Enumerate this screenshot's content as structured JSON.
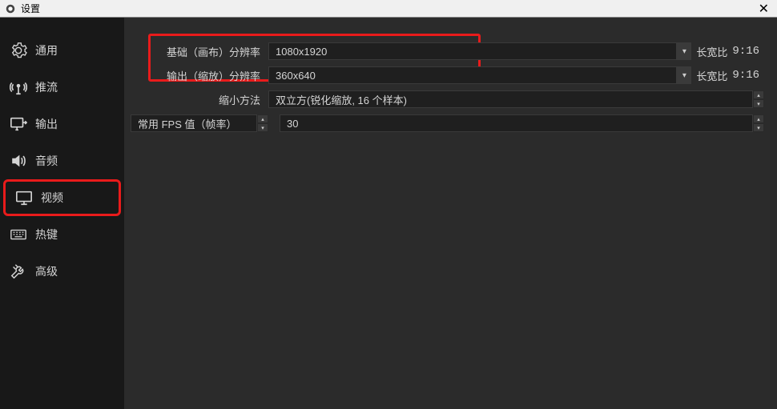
{
  "window": {
    "title": "设置",
    "close": "✕"
  },
  "sidebar": {
    "items": [
      {
        "label": "通用"
      },
      {
        "label": "推流"
      },
      {
        "label": "输出"
      },
      {
        "label": "音频"
      },
      {
        "label": "视频"
      },
      {
        "label": "热键"
      },
      {
        "label": "高级"
      }
    ]
  },
  "video": {
    "baseLabel": "基础（画布）分辨率",
    "baseValue": "1080x1920",
    "outputLabel": "输出（缩放）分辨率",
    "outputValue": "360x640",
    "aspectLabel": "长宽比",
    "aspectValue": "9:16",
    "scaleMethodLabel": "缩小方法",
    "scaleMethodValue": "双立方(锐化缩放, 16 个样本)",
    "fpsLabel": "常用 FPS 值（帧率）",
    "fpsValue": "30"
  }
}
